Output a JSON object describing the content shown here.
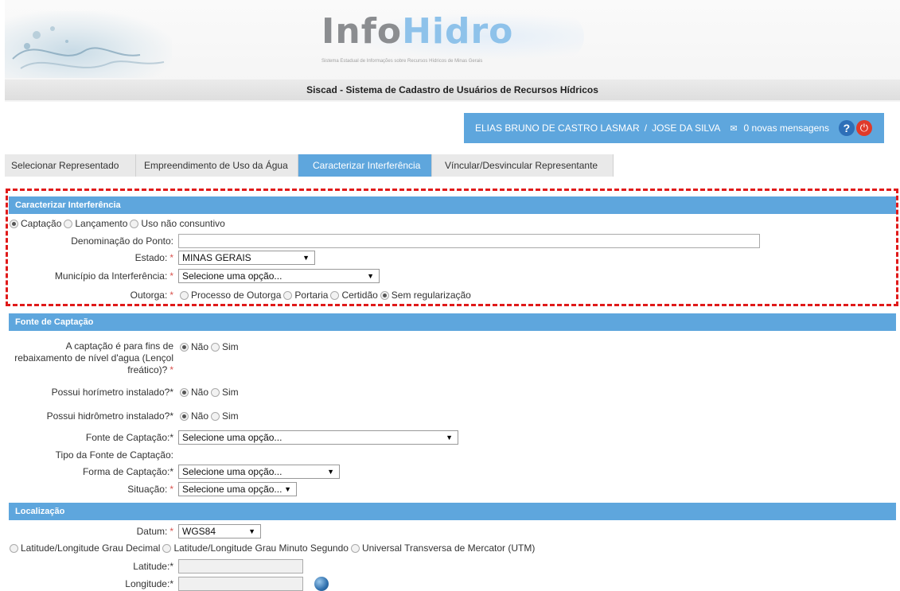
{
  "header": {
    "logo_part1": "Info",
    "logo_part2": "Hidro",
    "logo_subtitle": "Sistema Estadual de Informações sobre Recursos Hídricos de Minas Gerais",
    "system_title": "Siscad - Sistema de Cadastro de Usuários de Recursos Hídricos"
  },
  "userbar": {
    "user": "ELIAS BRUNO DE CASTRO LASMAR",
    "separator": "/",
    "represented": "JOSE DA SILVA",
    "messages": "0 novas mensagens",
    "help_glyph": "?",
    "power_glyph": "⏻",
    "mail_glyph": "✉"
  },
  "tabs": [
    {
      "label": "Selecionar Representado",
      "active": false
    },
    {
      "label": "Empreendimento de Uso da Água",
      "active": false
    },
    {
      "label": "Caracterizar Interferência",
      "active": true
    },
    {
      "label": "Víncular/Desvincular Representante",
      "active": false
    }
  ],
  "caracterizar": {
    "title": "Caracterizar Interferência",
    "tipo_options": [
      "Captação",
      "Lançamento",
      "Uso não consuntivo"
    ],
    "tipo_selected": "Captação",
    "denominacao_label": "Denominação do Ponto:",
    "denominacao_value": "",
    "estado_label": "Estado:",
    "estado_value": "MINAS GERAIS",
    "municipio_label": "Município da Interferência:",
    "municipio_value": "Selecione uma opção...",
    "outorga_label": "Outorga:",
    "outorga_options": [
      "Processo de Outorga",
      "Portaria",
      "Certidão",
      "Sem regularização"
    ],
    "outorga_selected": "Sem regularização"
  },
  "fonte": {
    "title": "Fonte de Captação",
    "rebaixamento_label_1": "A captação é para fins de",
    "rebaixamento_label_2": "rebaixamento de nível d'agua (Lençol",
    "rebaixamento_label_3": "freático)?",
    "horimetro_label": "Possui horímetro instalado?*",
    "hidrometro_label": "Possui hidrômetro instalado?*",
    "nao": "Não",
    "sim": "Sim",
    "fonte_label": "Fonte de Captação:*",
    "fonte_value": "Selecione uma opção...",
    "tipo_label": "Tipo da Fonte de Captação:",
    "forma_label": "Forma de Captação:*",
    "forma_value": "Selecione uma opção...",
    "situacao_label": "Situação:",
    "situacao_value": "Selecione uma opção..."
  },
  "localizacao": {
    "title": "Localização",
    "datum_label": "Datum:",
    "datum_value": "WGS84",
    "coord_options": [
      "Latitude/Longitude Grau Decimal",
      "Latitude/Longitude Grau Minuto Segundo",
      "Universal Transversa de Mercator (UTM)"
    ],
    "latitude_label": "Latitude:*",
    "longitude_label": "Longitude:*"
  },
  "common": {
    "required": "*",
    "arrow": "▼"
  },
  "colors": {
    "accent": "#5ea6dd",
    "highlight_border": "#e01a1a",
    "logo_gray": "#8b8d90",
    "logo_blue": "#8ec2ea"
  }
}
